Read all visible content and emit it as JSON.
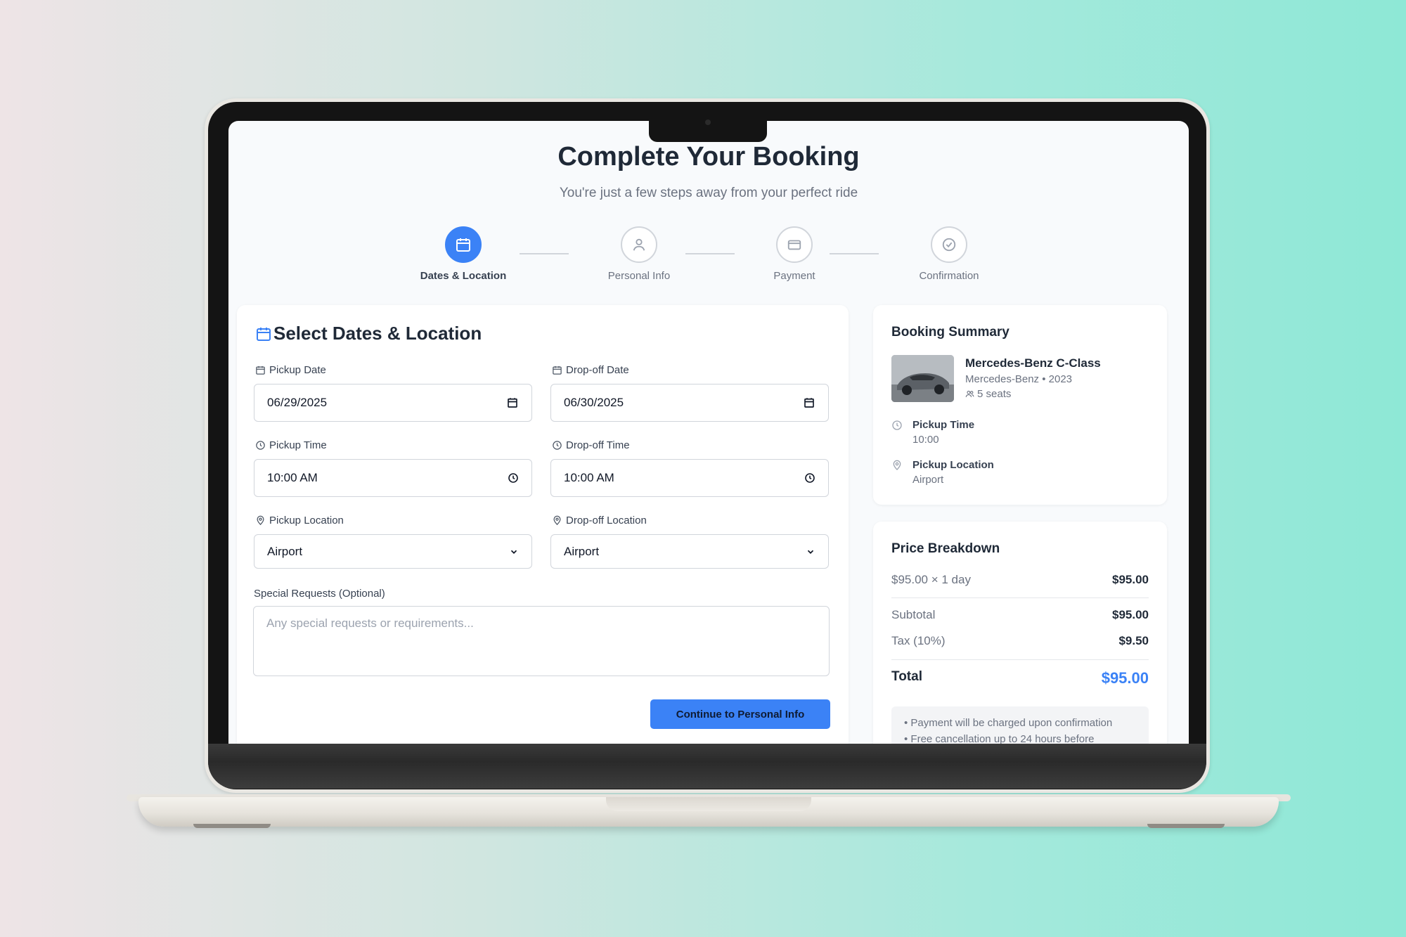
{
  "header": {
    "title": "Complete Your Booking",
    "subtitle": "You're just a few steps away from your perfect ride"
  },
  "steps": [
    {
      "label": "Dates & Location",
      "icon": "calendar-icon",
      "active": true
    },
    {
      "label": "Personal Info",
      "icon": "user-icon",
      "active": false
    },
    {
      "label": "Payment",
      "icon": "credit-card-icon",
      "active": false
    },
    {
      "label": "Confirmation",
      "icon": "check-circle-icon",
      "active": false
    }
  ],
  "form": {
    "title": "Select Dates & Location",
    "pickup_date": {
      "label": "Pickup Date",
      "value": "06/29/2025"
    },
    "dropoff_date": {
      "label": "Drop-off Date",
      "value": "06/30/2025"
    },
    "pickup_time": {
      "label": "Pickup Time",
      "value": "10:00 AM"
    },
    "dropoff_time": {
      "label": "Drop-off Time",
      "value": "10:00 AM"
    },
    "pickup_location": {
      "label": "Pickup Location",
      "value": "Airport"
    },
    "dropoff_location": {
      "label": "Drop-off Location",
      "value": "Airport"
    },
    "special_requests": {
      "label": "Special Requests (Optional)",
      "placeholder": "Any special requests or requirements..."
    },
    "continue_label": "Continue to Personal Info"
  },
  "summary": {
    "title": "Booking Summary",
    "car_name": "Mercedes-Benz C-Class",
    "car_meta": "Mercedes-Benz • 2023",
    "seats": "5 seats",
    "pickup_time_label": "Pickup Time",
    "pickup_time_value": "10:00",
    "pickup_location_label": "Pickup Location",
    "pickup_location_value": "Airport"
  },
  "price": {
    "title": "Price Breakdown",
    "rate_label": "$95.00 × 1 day",
    "rate_value": "$95.00",
    "subtotal_label": "Subtotal",
    "subtotal_value": "$95.00",
    "tax_label": "Tax (10%)",
    "tax_value": "$9.50",
    "total_label": "Total",
    "total_value": "$95.00",
    "notes": [
      "Payment will be charged upon confirmation",
      "Free cancellation up to 24 hours before"
    ]
  },
  "colors": {
    "accent": "#3b82f6",
    "background_left": "#eee4e6",
    "background_right": "#8ee8d6"
  }
}
